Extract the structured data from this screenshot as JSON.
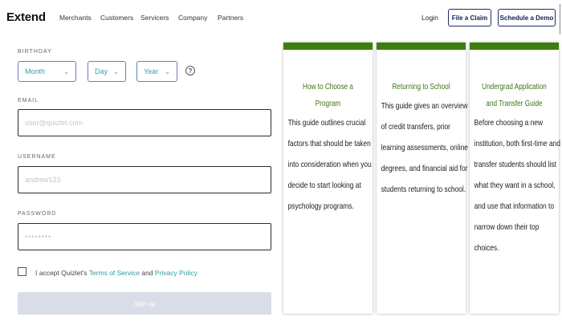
{
  "header": {
    "logo": "Extend",
    "nav": [
      "Merchants",
      "Customers",
      "Servicers",
      "Company",
      "Partners"
    ],
    "login": "Login",
    "file_claim": "File a Claim",
    "schedule_demo": "Schedule a Demo"
  },
  "form": {
    "birthday_label": "BIRTHDAY",
    "month": "Month",
    "day": "Day",
    "year": "Year",
    "help": "?",
    "email_label": "EMAIL",
    "email_placeholder": "user@quizlet.com",
    "username_label": "USERNAME",
    "username_placeholder": "andrew123",
    "password_label": "PASSWORD",
    "password_placeholder": "••••••••",
    "terms_prefix": "I accept Quizlet's",
    "terms_link": "Terms of Service",
    "terms_and": "and",
    "privacy_link": "Privacy Policy",
    "signup": "Sign up"
  },
  "cards": [
    {
      "title": "How to Choose a Program",
      "body": "This guide outlines crucial factors that should be taken into consideration when you decide to start looking at psychology programs."
    },
    {
      "title": "Returning to School",
      "body": "This guide gives an overview of credit transfers, prior learning assessments, online degrees, and financial aid for students returning to school."
    },
    {
      "title": "Undergrad Application and Transfer Guide",
      "body": "Before choosing a new institution, both first-time and transfer students should list what they want in a school, and use that information to narrow down their top choices."
    }
  ],
  "colors": {
    "card_accent": "#3e7e10",
    "card_title": "#3b7412",
    "link": "#2b9aa5",
    "button_border": "#1d2d6b",
    "signup_disabled": "#d9dde8"
  }
}
